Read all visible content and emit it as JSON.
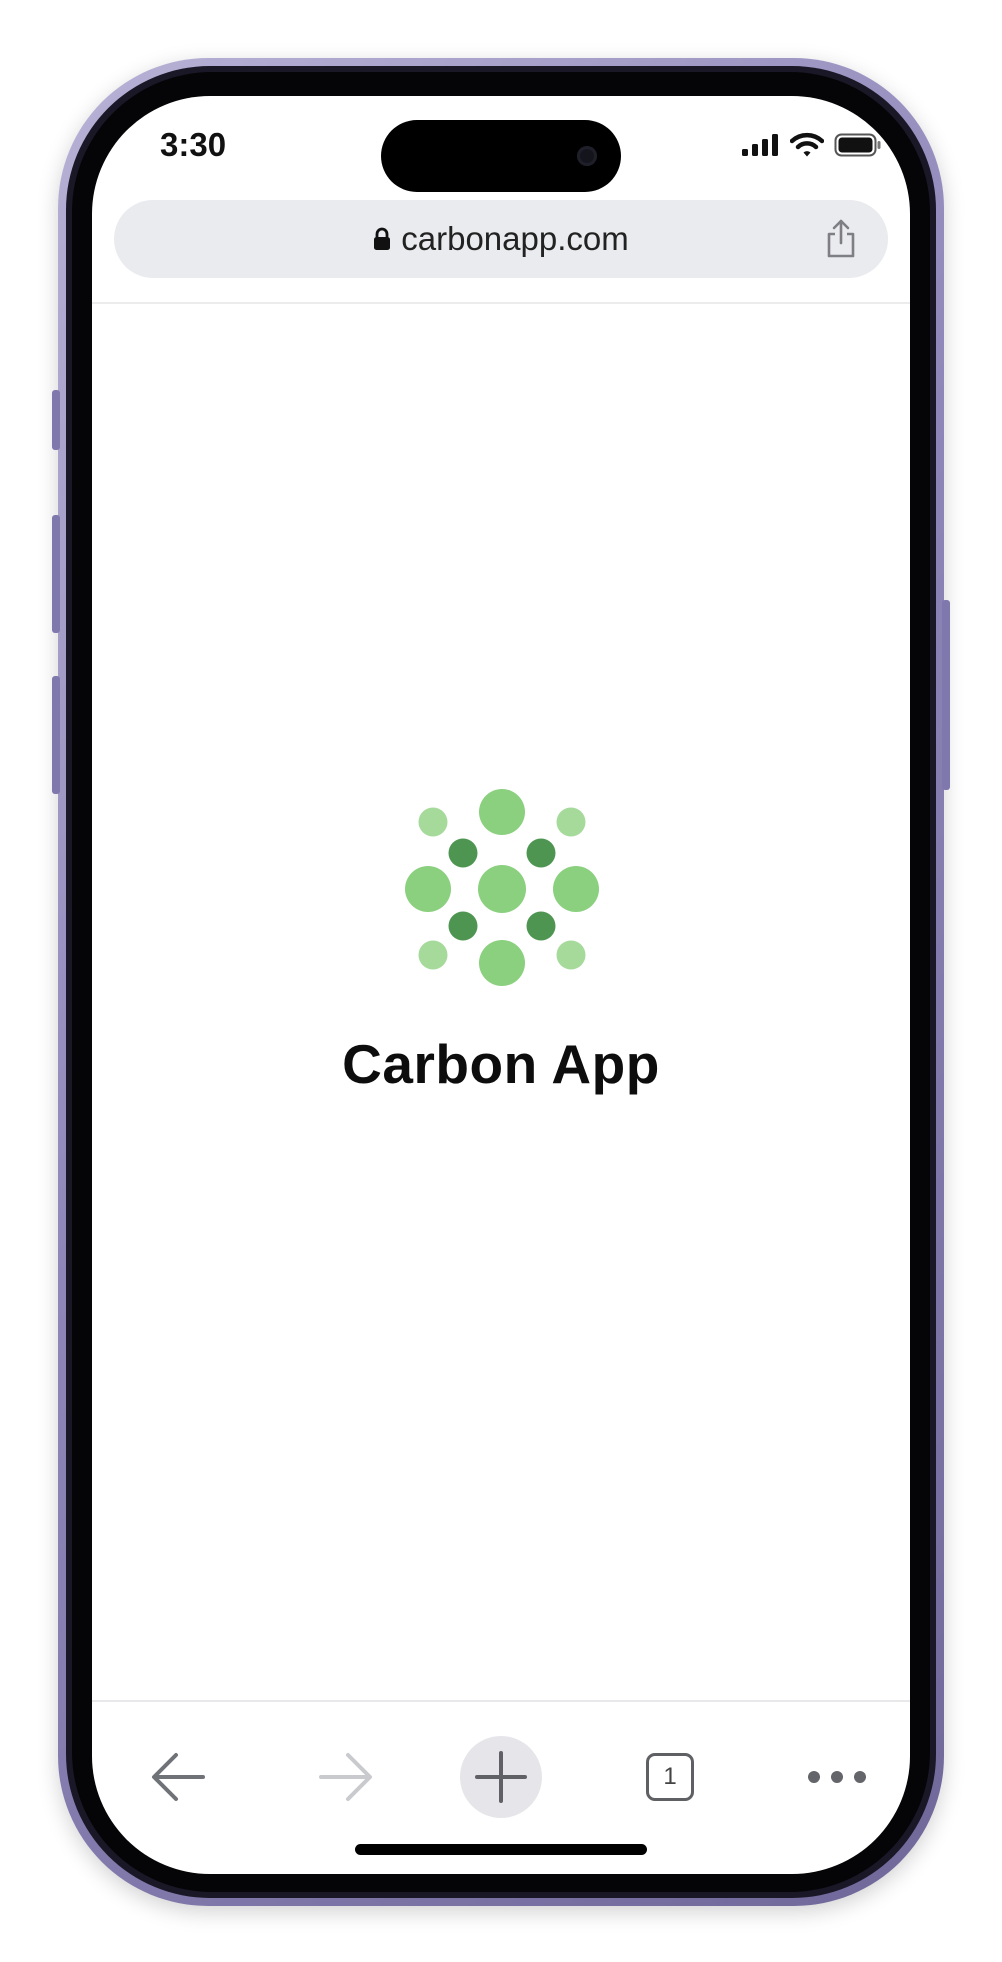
{
  "status_bar": {
    "time": "3:30"
  },
  "browser": {
    "url": "carbonapp.com",
    "tab_count": "1"
  },
  "page": {
    "app_name": "Carbon App"
  },
  "colors": {
    "logo_light": "#8ad07e",
    "logo_pale": "#a5da9b",
    "logo_dark": "#4d9551",
    "frame": "#8e86b8"
  },
  "icons": {
    "back": "arrow-left-icon",
    "forward": "arrow-right-icon",
    "new_tab": "plus-icon",
    "tabs": "tab-switcher-icon",
    "menu": "more-dots-icon",
    "share": "share-icon",
    "lock": "lock-icon"
  }
}
